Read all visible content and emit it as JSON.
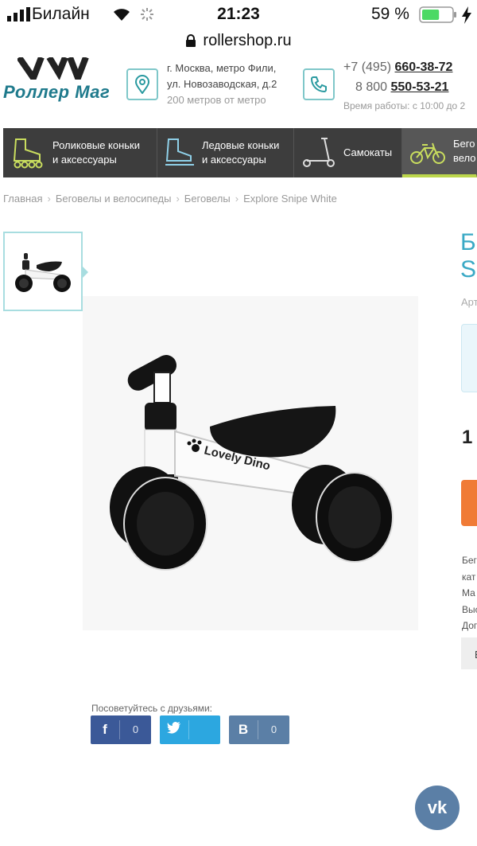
{
  "status_bar": {
    "carrier": "Билайн",
    "time": "21:23",
    "battery": "59 %",
    "battery_level": 0.59
  },
  "browser": {
    "url": "rollershop.ru"
  },
  "header": {
    "logo": "Роллер Маг",
    "address_line1": "г. Москва, метро Фили,",
    "address_line2": "ул. Новозаводская, д.2",
    "address_note": "200 метров от метро",
    "phone1_prefix": "+7 (495)",
    "phone1_number": "660-38-72",
    "phone2_prefix": "8 800",
    "phone2_number": "550-53-21",
    "hours": "Время работы: с 10:00 до 2"
  },
  "nav": [
    {
      "line1": "Роликовые коньки",
      "line2": "и аксессуары",
      "icon": "rollerskate-icon"
    },
    {
      "line1": "Ледовые коньки",
      "line2": "и аксессуары",
      "icon": "iceskate-icon"
    },
    {
      "line1": "Самокаты",
      "line2": "",
      "icon": "scooter-icon"
    },
    {
      "line1": "Бего",
      "line2": "вело",
      "icon": "bicycle-icon"
    }
  ],
  "breadcrumbs": [
    "Главная",
    "Беговелы и велосипеды",
    "Беговелы",
    "Explore Snipe White"
  ],
  "product": {
    "title_line1": "Б",
    "title_line2": "S",
    "article": "Арт",
    "price": "1",
    "desc": [
      "Бег",
      "кат",
      "Ма",
      "Выс",
      "Дог"
    ],
    "gray_btn": "Е",
    "brand_on_image": "Lovely Dino"
  },
  "share": {
    "label": "Посоветуйтесь с друзьями:",
    "buttons": [
      {
        "icon": "f",
        "count": "0",
        "color": "#3b5998"
      },
      {
        "icon": "twitter",
        "count": "",
        "color": "#2ca7e0"
      },
      {
        "icon": "В",
        "count": "0",
        "color": "#5b7fa6"
      }
    ]
  },
  "vk_widget": "vk",
  "colors": {
    "accent": "#3aa9c5",
    "nav_bg": "#3d3d3d",
    "nav_active_bar": "#bcd64b",
    "buy_button": "#f07b36"
  }
}
